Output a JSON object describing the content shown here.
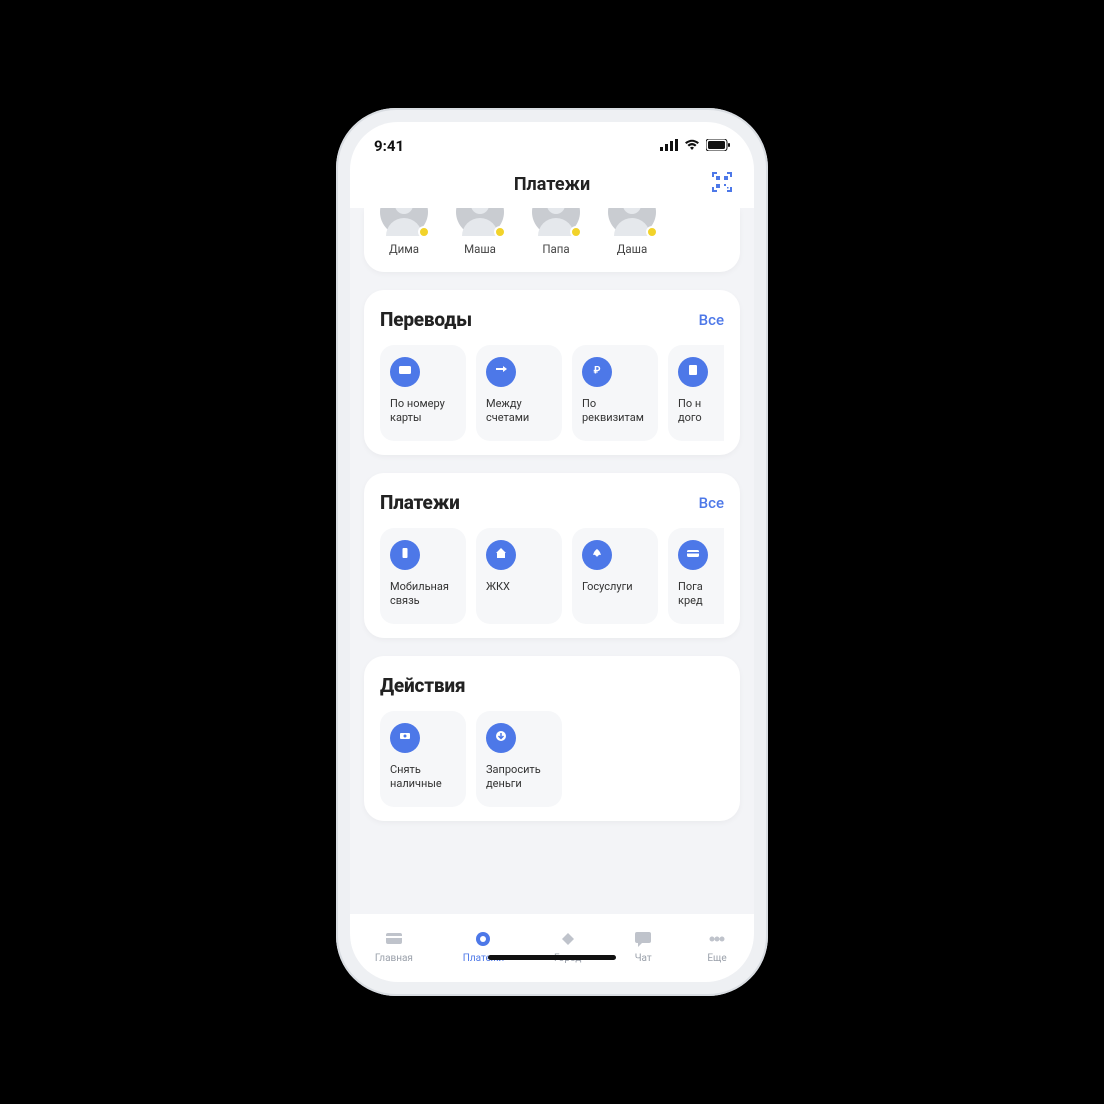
{
  "status": {
    "time": "9:41"
  },
  "nav": {
    "title": "Платежи"
  },
  "contacts": [
    {
      "name": "Дима"
    },
    {
      "name": "Маша"
    },
    {
      "name": "Папа"
    },
    {
      "name": "Даша"
    }
  ],
  "sections": {
    "transfers": {
      "title": "Переводы",
      "all": "Все",
      "items": [
        {
          "label": "По номеру карты",
          "icon": "card"
        },
        {
          "label": "Между счетами",
          "icon": "swap"
        },
        {
          "label": "По реквизитам",
          "icon": "ruble"
        },
        {
          "label": "По н\nдого",
          "icon": "doc"
        }
      ]
    },
    "payments": {
      "title": "Платежи",
      "all": "Все",
      "items": [
        {
          "label": "Мобильная связь",
          "icon": "phone"
        },
        {
          "label": "ЖКХ",
          "icon": "house"
        },
        {
          "label": "Госуслуги",
          "icon": "gov"
        },
        {
          "label": "Пога\nкред",
          "icon": "credit"
        }
      ]
    },
    "actions": {
      "title": "Действия",
      "items": [
        {
          "label": "Снять наличные",
          "icon": "cash"
        },
        {
          "label": "Запросить деньги",
          "icon": "download"
        }
      ]
    }
  },
  "tabs": [
    {
      "label": "Главная",
      "icon": "home",
      "active": false
    },
    {
      "label": "Платежи",
      "icon": "payments",
      "active": true
    },
    {
      "label": "Город",
      "icon": "city",
      "active": false
    },
    {
      "label": "Чат",
      "icon": "chat",
      "active": false
    },
    {
      "label": "Еще",
      "icon": "more",
      "active": false
    }
  ]
}
